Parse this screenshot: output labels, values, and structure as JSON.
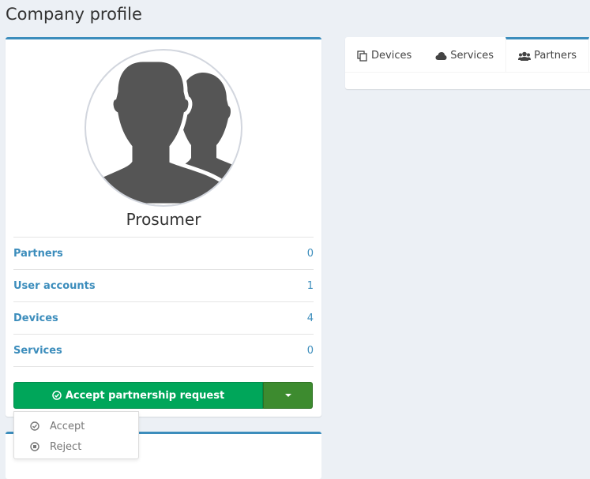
{
  "page": {
    "title": "Company profile"
  },
  "profile": {
    "name": "Prosumer",
    "stats": [
      {
        "label": "Partners",
        "value": "0"
      },
      {
        "label": "User accounts",
        "value": "1"
      },
      {
        "label": "Devices",
        "value": "4"
      },
      {
        "label": "Services",
        "value": "0"
      }
    ],
    "accept_button": "Accept partnership request",
    "dropdown": [
      {
        "label": "Accept",
        "icon": "check-circle-icon"
      },
      {
        "label": "Reject",
        "icon": "stop-circle-icon"
      }
    ]
  },
  "tabs": [
    {
      "label": "Devices",
      "icon": "copy-icon",
      "active": false
    },
    {
      "label": "Services",
      "icon": "cloud-icon",
      "active": false
    },
    {
      "label": "Partners",
      "icon": "users-icon",
      "active": true
    }
  ],
  "colors": {
    "accent": "#3c8dbc",
    "success": "#00a65a",
    "background": "#ecf0f5"
  }
}
